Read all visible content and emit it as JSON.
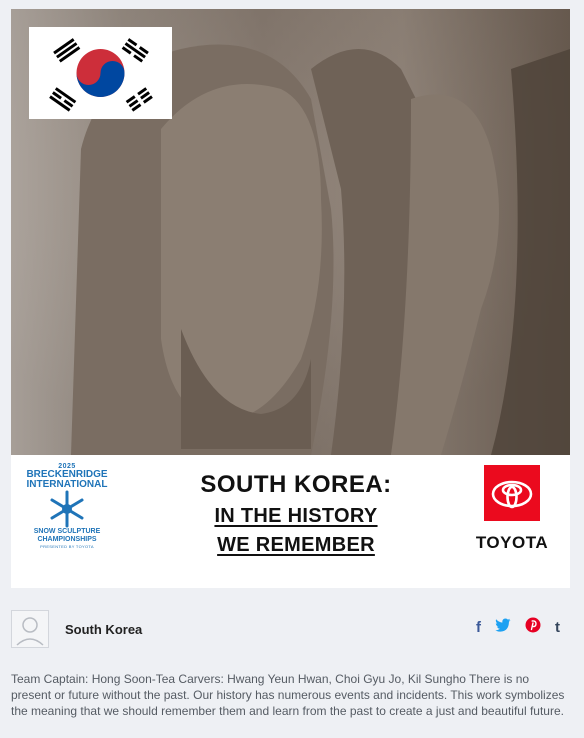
{
  "sponsor_left": {
    "year": "2025",
    "line1": "BRECKENRIDGE",
    "line2": "INTERNATIONAL",
    "line3": "SNOW SCULPTURE",
    "line4": "CHAMPIONSHIPS",
    "line5": "PRESENTED BY TOYOTA"
  },
  "headline": {
    "line1": "SOUTH KOREA:",
    "line2": "IN THE HISTORY",
    "line3": "WE REMEMBER"
  },
  "sponsor_right": {
    "word": "TOYOTA"
  },
  "author": {
    "name": "South Korea"
  },
  "social": {
    "facebook": "f",
    "twitter": "t",
    "pinterest": "p",
    "tumblr": "t"
  },
  "description": "Team Captain: Hong Soon-Tea Carvers: Hwang Yeun Hwan, Choi Gyu Jo, Kil Sungho There is no present or future without the past. Our history has numerous events and incidents. This work symbolizes the meaning that we should remember them and learn from the past to create a just and beautiful future.",
  "colors": {
    "brand_blue": "#1f74b8",
    "toyota_red": "#eb0a1e",
    "facebook": "#3b5998",
    "twitter": "#1da1f2",
    "pinterest": "#e60023",
    "tumblr": "#35465c"
  }
}
